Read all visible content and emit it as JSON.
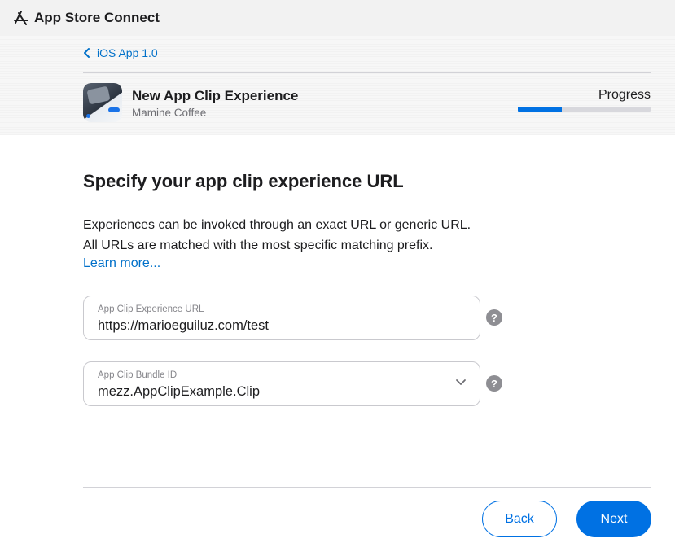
{
  "topbar": {
    "title": "App Store Connect",
    "icon": "app-store-icon"
  },
  "breadcrumb": {
    "label": "iOS App 1.0",
    "icon": "chevron-left-icon"
  },
  "experience": {
    "name": "New App Clip Experience",
    "subtitle": "Mamine Coffee",
    "progress_label": "Progress",
    "progress_fraction": 0.33
  },
  "main": {
    "heading": "Specify your app clip experience URL",
    "description_line1": "Experiences can be invoked through an exact URL or generic URL.",
    "description_line2": "All URLs are matched with the most specific matching prefix.",
    "learn_more": "Learn more..."
  },
  "fields": {
    "url": {
      "label": "App Clip Experience URL",
      "value": "https://marioeguiluz.com/test",
      "help": "?"
    },
    "bundle": {
      "label": "App Clip Bundle ID",
      "value": "mezz.AppClipExample.Clip",
      "help": "?"
    }
  },
  "footer": {
    "back_label": "Back",
    "next_label": "Next"
  },
  "colors": {
    "accent": "#0071e3",
    "link": "#0070c9",
    "help_badge": "#8e8e93"
  }
}
